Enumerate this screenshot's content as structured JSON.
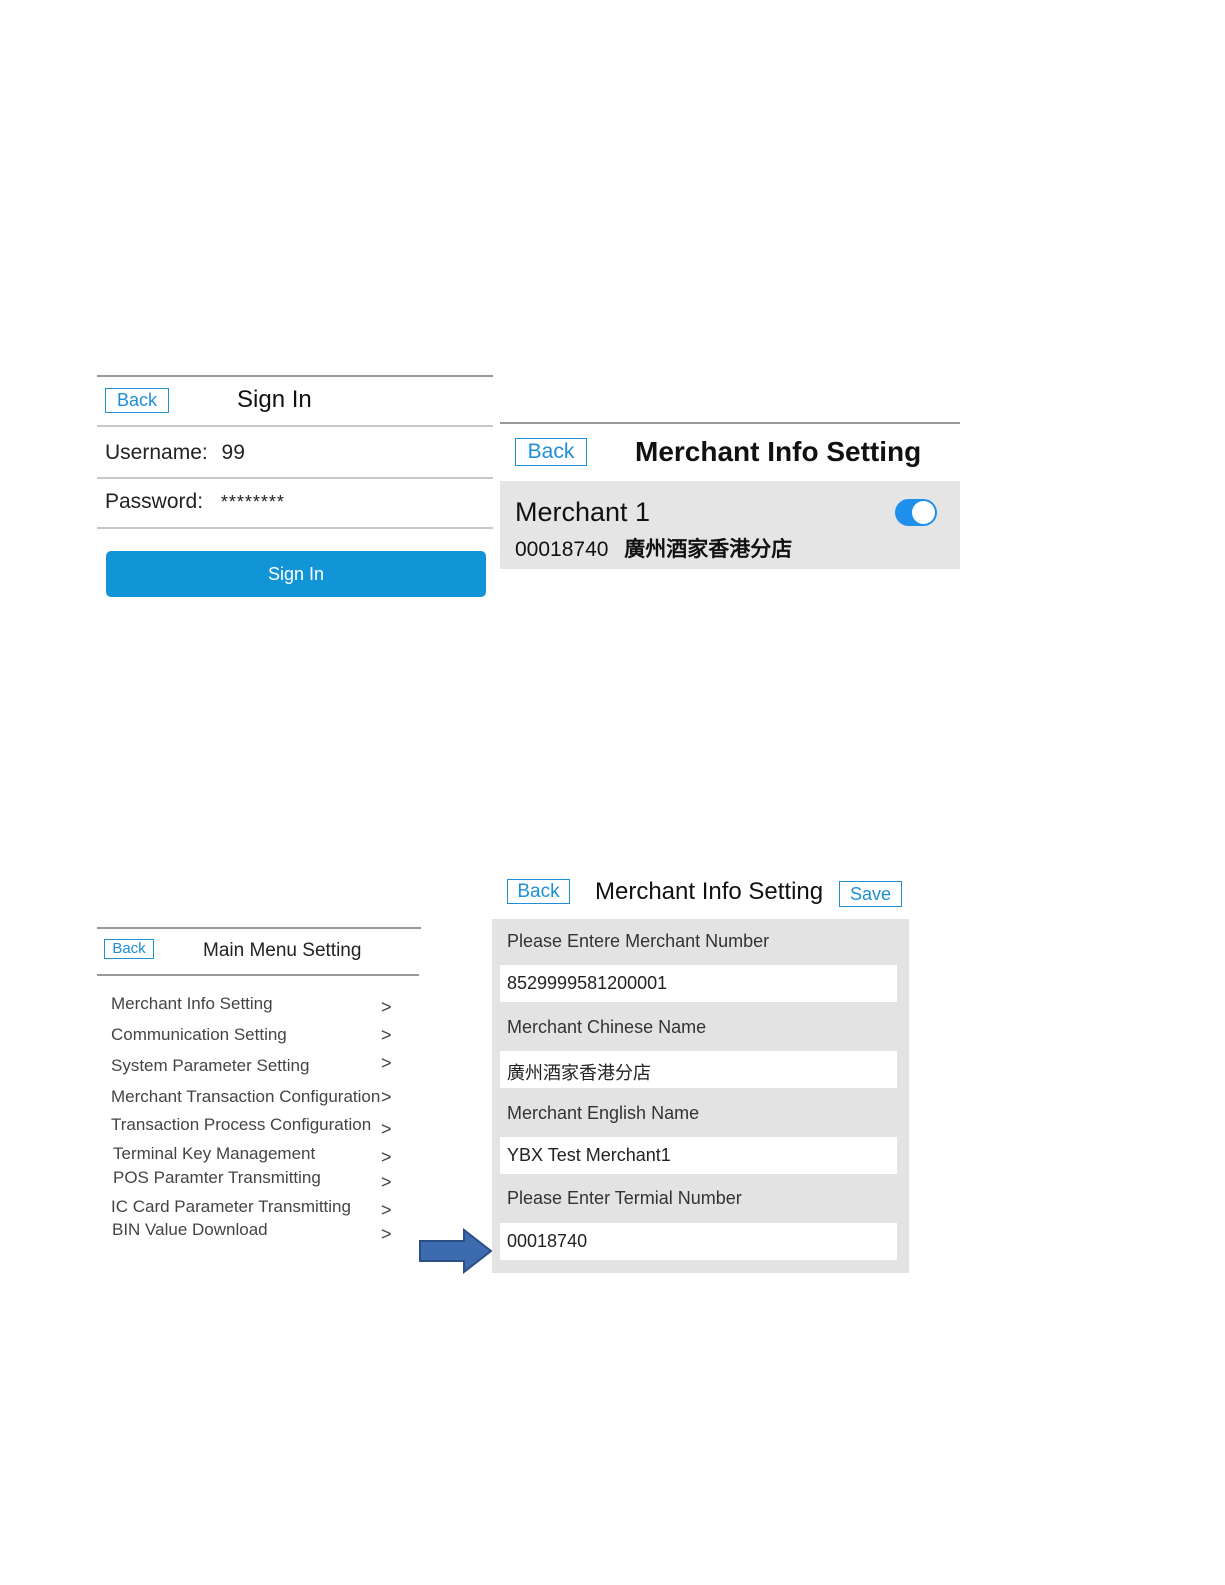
{
  "sign_in": {
    "back_label": "Back",
    "title": "Sign In",
    "username_label": "Username:",
    "username_value": "99",
    "password_label": "Password:",
    "password_value": "********",
    "submit_label": "Sign In",
    "accent_color": "#1295d6"
  },
  "merchant_info": {
    "back_label": "Back",
    "title": "Merchant Info Setting",
    "merchant_name": "Merchant 1",
    "merchant_terminal": "00018740",
    "merchant_chinese": "廣州酒家香港分店",
    "toggle_on": true,
    "toggle_color": "#1e8fea"
  },
  "main_menu": {
    "back_label": "Back",
    "title": "Main Menu Setting",
    "chevron": ">",
    "items": [
      "Merchant Info Setting",
      "Communication Setting",
      "System Parameter Setting",
      "Merchant Transaction Configuration",
      "Transaction Process Configuration",
      "Terminal Key Management",
      "POS Paramter Transmitting",
      "IC Card Parameter Transmitting",
      "BIN Value Download"
    ]
  },
  "merchant_edit": {
    "back_label": "Back",
    "title": "Merchant Info Setting",
    "save_label": "Save",
    "fields": [
      {
        "label": "Please Entere Merchant Number",
        "value": "8529999581200001"
      },
      {
        "label": "Merchant Chinese Name",
        "value": "廣州酒家香港分店"
      },
      {
        "label": "Merchant English Name",
        "value": "YBX Test Merchant1"
      },
      {
        "label": "Please Enter Termial Number",
        "value": "00018740"
      }
    ],
    "arrow_color": "#3d6bb0"
  }
}
